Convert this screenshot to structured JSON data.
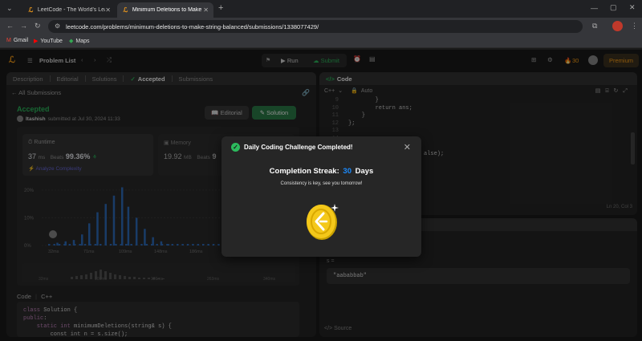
{
  "browser": {
    "tabs": [
      {
        "title": "LeetCode - The World's Leading"
      },
      {
        "title": "Minimum Deletions to Make Str"
      }
    ],
    "url": "leetcode.com/problems/minimum-deletions-to-make-string-balanced/submissions/1338077429/",
    "bookmarks": [
      {
        "label": "Gmail"
      },
      {
        "label": "YouTube"
      },
      {
        "label": "Maps"
      }
    ]
  },
  "nav": {
    "problem_list": "Problem List",
    "run": "Run",
    "submit": "Submit",
    "streak_count": "30",
    "premium": "Premium"
  },
  "left_panel": {
    "tabs": [
      {
        "label": "Description"
      },
      {
        "label": "Editorial"
      },
      {
        "label": "Solutions"
      },
      {
        "label": "Accepted"
      },
      {
        "label": "Submissions"
      }
    ],
    "back_label": "All Submissions",
    "status": "Accepted",
    "author": "Itashish",
    "submitted_text": "submitted at Jul 30, 2024 11:33",
    "editorial_button": "Editorial",
    "solution_button": "Solution",
    "runtime_label": "Runtime",
    "runtime_value": "37",
    "runtime_unit": "ms",
    "beats_label": "Beats",
    "beats_value": "99.36%",
    "analyze_label": "Analyze Complexity",
    "memory_label": "Memory",
    "memory_value": "19.92",
    "memory_unit": "MB",
    "memory_beats": "Beats",
    "memory_beats_value": "9",
    "y_ticks": [
      "20%",
      "10%",
      "0%"
    ],
    "x_ticks": [
      "32ms",
      "71ms",
      "109ms",
      "148ms",
      "186ms",
      "224ms",
      "263ms"
    ],
    "mini_ticks": [
      "32ms",
      "109ms",
      "186ms",
      "263ms",
      "340ms"
    ],
    "code_header": "Code",
    "code_lang": "C++",
    "code_lines": [
      {
        "kw": "class",
        "rest": " Solution {"
      },
      {
        "kw": "public",
        "rest": ":"
      },
      {
        "kw": "    static int",
        "rest": " minimumDeletions(string& s) {"
      },
      {
        "kw": "",
        "rest": "        const int n = s.size();"
      }
    ]
  },
  "right_panel": {
    "tab": "Code",
    "lang": "C++",
    "mode": "Auto",
    "line_numbers": [
      "9",
      "10",
      "11",
      "12",
      "13",
      "14"
    ],
    "code_lines": [
      "        }",
      "        return ans;",
      "    }",
      "};",
      "",
      ""
    ],
    "partial_code": "alse);",
    "partial_code2": "};",
    "cursor_pos": "Ln 20, Col 3"
  },
  "right_panel2": {
    "var_label": "s =",
    "input_value": "\"aababbab\"",
    "source_label": "Source"
  },
  "modal": {
    "title": "Daily Coding Challenge Completed!",
    "streak_label": "Completion Streak:",
    "streak_value": "30",
    "streak_unit": "Days",
    "message": "Consistency is key, see you tomorrow!"
  },
  "chart_data": {
    "type": "bar",
    "description_free": true,
    "x": [
      32,
      40,
      48,
      56,
      64,
      71,
      79,
      87,
      95,
      103,
      109,
      117,
      125,
      133,
      141,
      148
    ],
    "values": [
      0.5,
      1,
      1.5,
      2,
      4,
      8,
      12,
      15,
      18,
      21,
      14,
      10,
      6,
      3,
      1.5,
      0.5
    ],
    "ylim": [
      0,
      22
    ],
    "highlight_index": 0,
    "colors": {
      "bar": "#2f6dbe",
      "highlight": "#2f6dbe",
      "dot": "#4b7fd6"
    }
  },
  "colors": {
    "accent": "#ffa116",
    "green": "#2cbb5d",
    "blue": "#1c8cff",
    "modal_bg": "#262626"
  }
}
